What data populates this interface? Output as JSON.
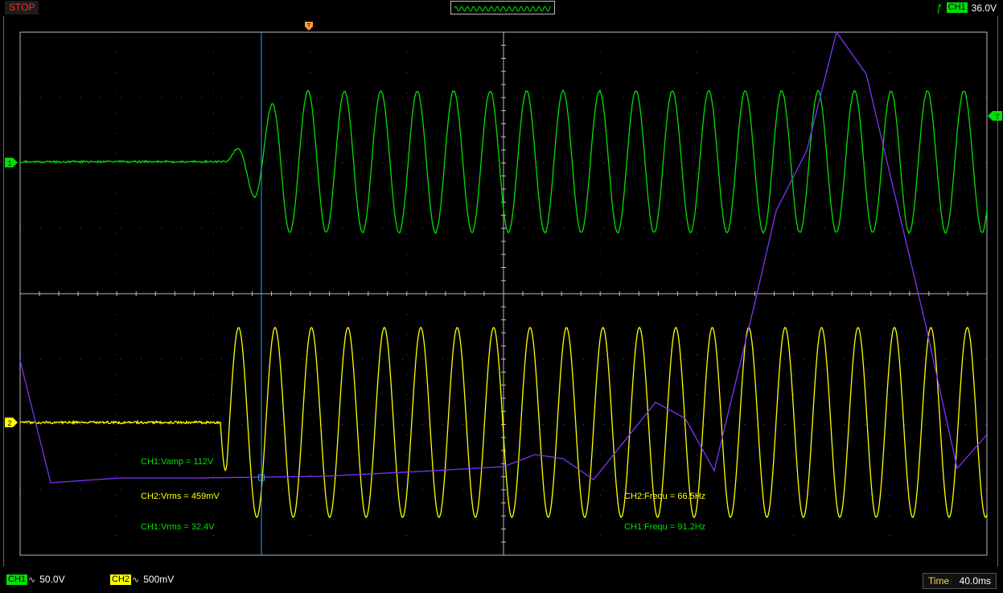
{
  "status": {
    "run_state": "STOP"
  },
  "trigger": {
    "edge_icon": "rising-edge-icon",
    "source": "CH1",
    "level": "36.0V"
  },
  "measurements": {
    "ch1_vamp": "CH1:Vamp = 112V",
    "ch2_vrms": "CH2:Vrms = 459mV",
    "ch1_vrms": "CH1:Vrms = 32.4V",
    "ch2_frequ": "CH2:Frequ = 66.5Hz",
    "ch1_frequ": "CH1:Frequ = 91.2Hz"
  },
  "markers": {
    "ch1": "1",
    "ch2": "2",
    "trigger_pos": "T",
    "trigger_level": "T"
  },
  "channels": [
    {
      "name": "CH1",
      "coupling_icon": "ac-coupling-icon",
      "scale": "50.0V",
      "color": "#00e000"
    },
    {
      "name": "CH2",
      "coupling_icon": "ac-coupling-icon",
      "scale": "500mV",
      "color": "#ffff00"
    }
  ],
  "timebase": {
    "label": "Time",
    "value": "40.0ms"
  },
  "colors": {
    "ch1": "#00e000",
    "ch2": "#ffff00",
    "cursor": "#2aa0ff",
    "math": "#7d33ff",
    "stop": "#ff2a2a"
  }
}
